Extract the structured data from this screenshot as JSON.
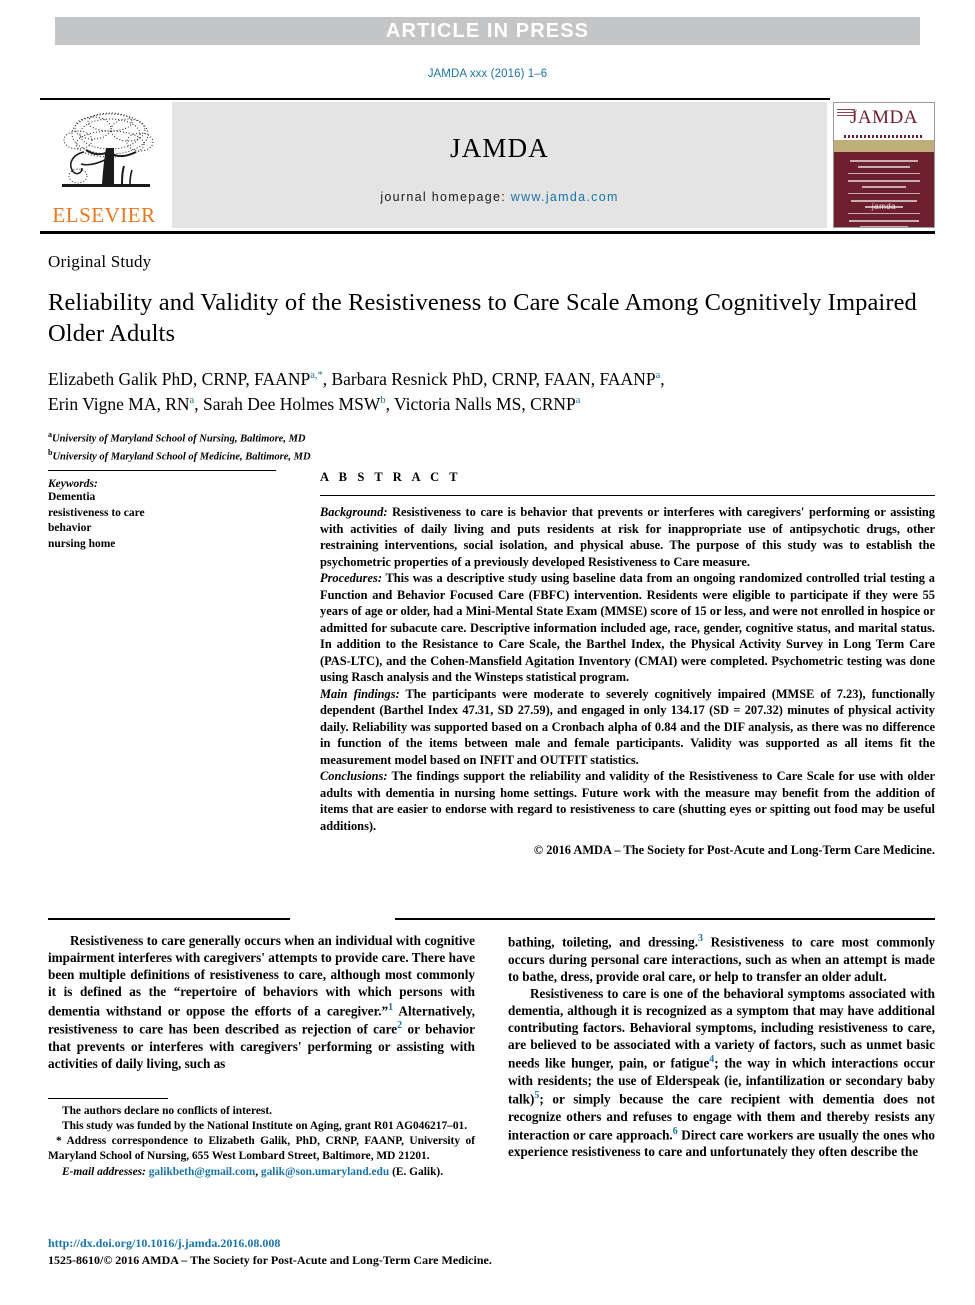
{
  "banner": {
    "text": "ARTICLE IN PRESS"
  },
  "running_head": "JAMDA xxx (2016) 1–6",
  "masthead": {
    "publisher": "ELSEVIER",
    "journal": "JAMDA",
    "homepage_label": "journal homepage:",
    "homepage_url": "www.jamda.com",
    "cover_title": "JAMDA",
    "cover_logo": "jamda"
  },
  "article": {
    "type": "Original Study",
    "title": "Reliability and Validity of the Resistiveness to Care Scale Among Cognitively Impaired Older Adults",
    "authors_line1": "Elizabeth Galik PhD, CRNP, FAANP",
    "authors_line1_sup": "a,*",
    "authors_line1b": ", Barbara Resnick PhD, CRNP, FAAN, FAANP",
    "authors_line1b_sup": "a",
    "authors_line2a": "Erin Vigne MA, RN",
    "authors_line2a_sup": "a",
    "authors_line2b": ", Sarah Dee Holmes MSW",
    "authors_line2b_sup": "b",
    "authors_line2c": ", Victoria Nalls MS, CRNP",
    "authors_line2c_sup": "a",
    "affiliations": [
      {
        "marker": "a",
        "text": "University of Maryland School of Nursing, Baltimore, MD"
      },
      {
        "marker": "b",
        "text": "University of Maryland School of Medicine, Baltimore, MD"
      }
    ]
  },
  "keywords": {
    "title": "Keywords:",
    "items": [
      "Dementia",
      "resistiveness to care",
      "behavior",
      "nursing home"
    ]
  },
  "abstract": {
    "label": "A B S T R A C T",
    "sections": [
      {
        "heading": "Background:",
        "text": " Resistiveness to care is behavior that prevents or interferes with caregivers' performing or assisting with activities of daily living and puts residents at risk for inappropriate use of antipsychotic drugs, other restraining interventions, social isolation, and physical abuse. The purpose of this study was to establish the psychometric properties of a previously developed Resistiveness to Care measure."
      },
      {
        "heading": "Procedures:",
        "text": " This was a descriptive study using baseline data from an ongoing randomized controlled trial testing a Function and Behavior Focused Care (FBFC) intervention. Residents were eligible to participate if they were 55 years of age or older, had a Mini-Mental State Exam (MMSE) score of 15 or less, and were not enrolled in hospice or admitted for subacute care. Descriptive information included age, race, gender, cognitive status, and marital status. In addition to the Resistance to Care Scale, the Barthel Index, the Physical Activity Survey in Long Term Care (PAS-LTC), and the Cohen-Mansfield Agitation Inventory (CMAI) were completed. Psychometric testing was done using Rasch analysis and the Winsteps statistical program."
      },
      {
        "heading": "Main findings:",
        "text": " The participants were moderate to severely cognitively impaired (MMSE of 7.23), functionally dependent (Barthel Index 47.31, SD 27.59), and engaged in only 134.17 (SD = 207.32) minutes of physical activity daily. Reliability was supported based on a Cronbach alpha of 0.84 and the DIF analysis, as there was no difference in function of the items between male and female participants. Validity was supported as all items fit the measurement model based on INFIT and OUTFIT statistics."
      },
      {
        "heading": "Conclusions:",
        "text": " The findings support the reliability and validity of the Resistiveness to Care Scale for use with older adults with dementia in nursing home settings. Future work with the measure may benefit from the addition of items that are easier to endorse with regard to resistiveness to care (shutting eyes or spitting out food may be useful additions)."
      }
    ],
    "copyright": "© 2016 AMDA – The Society for Post-Acute and Long-Term Care Medicine."
  },
  "body": {
    "left": [
      {
        "part1": "Resistiveness to care generally occurs when an individual with cognitive impairment interferes with caregivers' attempts to provide care. There have been multiple definitions of resistiveness to care, although most commonly it is defined as the “repertoire of behaviors with which persons with dementia withstand or oppose the efforts of a caregiver.”",
        "ref1": "1",
        "part2": " Alternatively, resistiveness to care has been described as rejection of care",
        "ref2": "2",
        "part3": " or behavior that prevents or interferes with caregivers' performing or assisting with activities of daily living, such as"
      }
    ],
    "right": [
      {
        "part1": "bathing, toileting, and dressing.",
        "ref1": "3",
        "part2": " Resistiveness to care most commonly occurs during personal care interactions, such as when an attempt is made to bathe, dress, provide oral care, or help to transfer an older adult."
      },
      {
        "part1": "Resistiveness to care is one of the behavioral symptoms associated with dementia, although it is recognized as a symptom that may have additional contributing factors. Behavioral symptoms, including resistiveness to care, are believed to be associated with a variety of factors, such as unmet basic needs like hunger, pain, or fatigue",
        "ref1": "4",
        "part2": "; the way in which interactions occur with residents; the use of Elderspeak (ie, infantilization or secondary baby talk)",
        "ref2": "5",
        "part3": "; or simply because the care recipient with dementia does not recognize others and refuses to engage with them and thereby resists any interaction or care approach.",
        "ref3": "6",
        "part4": " Direct care workers are usually the ones who experience resistiveness to care and unfortunately they often describe the"
      }
    ]
  },
  "footnotes": {
    "conflict": "The authors declare no conflicts of interest.",
    "funding": "This study was funded by the National Institute on Aging, grant R01 AG046217–01.",
    "correspondence": "Address correspondence to Elizabeth Galik, PhD, CRNP, FAANP, University of Maryland School of Nursing, 655 West Lombard Street, Baltimore, MD 21201.",
    "email_label": "E-mail addresses:",
    "email1": "galikbeth@gmail.com",
    "email2": "galik@son.umaryland.edu",
    "email_owner": "(E. Galik).",
    "doi": "http://dx.doi.org/10.1016/j.jamda.2016.08.008",
    "issn": "1525-8610/© 2016 AMDA – The Society for Post-Acute and Long-Term Care Medicine."
  },
  "colors": {
    "link": "#1b74a8",
    "banner_bg": "#c3c5c7",
    "elsevier_orange": "#e87722",
    "cover_maroon": "#6d1f2e",
    "masthead_gray": "#e4e4e4"
  }
}
